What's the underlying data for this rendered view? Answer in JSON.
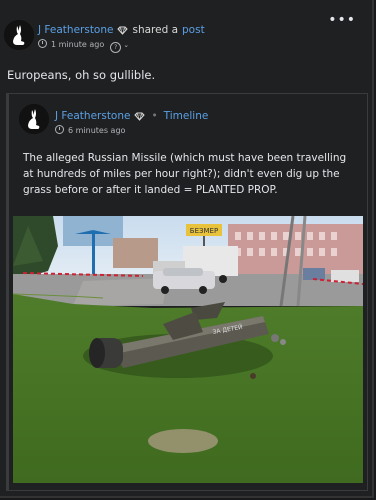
{
  "post": {
    "author": "J Featherstone",
    "action": "shared a",
    "post_link": "post",
    "time": "1 minute ago",
    "body": "Europeans, oh so gullible.",
    "more_label": "•••"
  },
  "shared_post": {
    "author": "J Featherstone",
    "separator": "•",
    "location": "Timeline",
    "time": "6 minutes ago",
    "text": "The alleged Russian Missile (which must have been travelling at hundreds of miles per hour right?); didn't even dig up the grass before or after it landed = PLANTED PROP.",
    "photo_sign_text": "БЕЗМЕР",
    "missile_text": "ЗА ДЕТЕЙ"
  },
  "colors": {
    "link": "#5aa0e6",
    "background": "#1f2021",
    "text": "#e4e6eb"
  },
  "icons": [
    "rabbit-avatar-icon",
    "verified-diamond-icon",
    "clock-icon",
    "globe-icon",
    "more-options-icon"
  ]
}
